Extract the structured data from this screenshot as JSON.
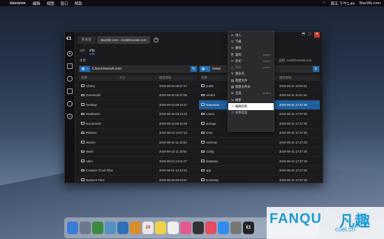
{
  "menubar": {
    "app": "electerm",
    "items": [
      "编辑",
      "视图",
      "窗口",
      "帮助"
    ],
    "clock": "周五 下午1:44",
    "user": "MacWk.com"
  },
  "window": {
    "logo": "€1",
    "tabs": [
      "新会话",
      "MacWk.com - root@macwk.com"
    ],
    "plus": "+",
    "controls": [
      "⬒",
      "▢",
      "✕"
    ],
    "subtabs": [
      "ssh",
      "sftp"
    ],
    "local_label": "本地",
    "remote_label": "远程: root@macwk.com",
    "local_path": "/Users/macwk.com",
    "remote_path": "/www",
    "local_headers": [
      "名称",
      "大小",
      "修改时间"
    ],
    "remote_headers": [
      "名称",
      "",
      "",
      "修改时间"
    ],
    "local_rows": [
      {
        "name": "Library",
        "size": "",
        "time": "2019-09-20 09:37:47"
      },
      {
        "name": "Downloads",
        "size": "",
        "time": "2019-09-20 09:37:06"
      },
      {
        "name": "Desktop",
        "size": "",
        "time": "2019-09-16 08:16:17"
      },
      {
        "name": "Databases",
        "size": "",
        "time": "2019-09-16 08:13:42"
      },
      {
        "name": "Documents",
        "size": "",
        "time": "2019-09-16 08:16:28"
      },
      {
        "name": "Pictures",
        "size": "",
        "time": "2019-09-13 12:07:12"
      },
      {
        "name": "Movies",
        "size": "",
        "time": "2019-09-10 11:18:54"
      },
      {
        "name": "Music",
        "size": "",
        "time": "2019-09-10 11:18:54"
      },
      {
        "name": "Adlm",
        "size": "",
        "time": "2019-09-04 13:01:27"
      },
      {
        "name": "Creative Cloud Files",
        "size": "",
        "time": "2019-09-01 12:43:24"
      },
      {
        "name": "Nutstore Files",
        "size": "",
        "time": "2019-08-28 20:23:57"
      }
    ],
    "remote_rows": [
      {
        "name": "public",
        "time": "2019-04-11 18:00:31"
      },
      {
        "name": "vendor",
        "time": "2019-04-11 10:01:44"
      },
      {
        "name": "resources",
        "time": "2019-05-31 17:37:30"
      },
      {
        "name": "routes",
        "time": "2019-05-31 17:37:30"
      },
      {
        "name": "storage",
        "time": "2019-05-31 17:37:30"
      },
      {
        "name": "tests",
        "time": "2019-05-31 17:37:30"
      },
      {
        "name": "common",
        "time": "2019-05-31 17:37:30"
      },
      {
        "name": "config",
        "time": "2019-05-31 17:37:30"
      },
      {
        "name": "database",
        "time": "2019-05-31 17:37:30"
      },
      {
        "name": "app",
        "time": "2019-05-31 17:37:30"
      },
      {
        "name": "bootstrap",
        "time": "2019-05-31 17:37:30"
      }
    ]
  },
  "context_menu": [
    {
      "label": "进入",
      "icon": "↵",
      "key": "",
      "state": "normal"
    },
    {
      "label": "下载",
      "icon": "⊙",
      "key": "",
      "state": "normal"
    },
    {
      "label": "删除",
      "icon": "⊙",
      "key": "",
      "state": "normal"
    },
    {
      "label": "复制",
      "icon": "⎘",
      "key": "cmd+c",
      "state": "normal"
    },
    {
      "label": "剪切",
      "icon": "✂",
      "key": "cmd+x",
      "state": "normal"
    },
    {
      "label": "粘贴",
      "icon": "⎗",
      "key": "cmd+v",
      "state": "disabled"
    },
    {
      "label": "重命名",
      "icon": "✎",
      "key": "",
      "state": "normal"
    },
    {
      "label": "新建文件",
      "icon": "▤",
      "key": "",
      "state": "normal"
    },
    {
      "label": "新建文件夹",
      "icon": "▤",
      "key": "",
      "state": "normal"
    },
    {
      "label": "全选",
      "icon": "⊙",
      "key": "cmd+a",
      "state": "normal"
    },
    {
      "label": "刷新",
      "icon": "⊙",
      "key": "",
      "state": "normal"
    },
    {
      "label": "编辑权限",
      "icon": "⚠",
      "key": "",
      "state": "highlighted"
    },
    {
      "label": "文件信息",
      "icon": "ⓘ",
      "key": "",
      "state": "normal"
    }
  ],
  "dock": [
    {
      "name": "finder",
      "color": "#3a7bd5"
    },
    {
      "name": "launchpad",
      "color": "#6b7a8a"
    },
    {
      "name": "chrome",
      "color": "#3b8a3e"
    },
    {
      "name": "preview",
      "color": "#5590c0"
    },
    {
      "name": "xcode",
      "color": "#2c6fb5"
    },
    {
      "name": "pages",
      "color": "#d98c2b"
    },
    {
      "name": "calendar",
      "color": "#e8e8e8"
    },
    {
      "name": "notes",
      "color": "#f2d14a"
    },
    {
      "name": "reminders",
      "color": "#f0f0f0"
    },
    {
      "name": "photos",
      "color": "#e45a8e"
    },
    {
      "name": "mission-control",
      "color": "#333"
    },
    {
      "name": "music",
      "color": "#e84a5f"
    },
    {
      "name": "app-store",
      "color": "#2f8df0"
    },
    {
      "name": "system-preferences",
      "color": "#777"
    },
    {
      "name": "electerm",
      "color": "#222"
    }
  ],
  "dock_calendar_day": "20",
  "dock_electerm": "€1",
  "watermark": {
    "text1": "FANQU",
    "text2": "凡趣",
    "text3": "cuel.cn",
    "color": "#1d9bd8"
  }
}
